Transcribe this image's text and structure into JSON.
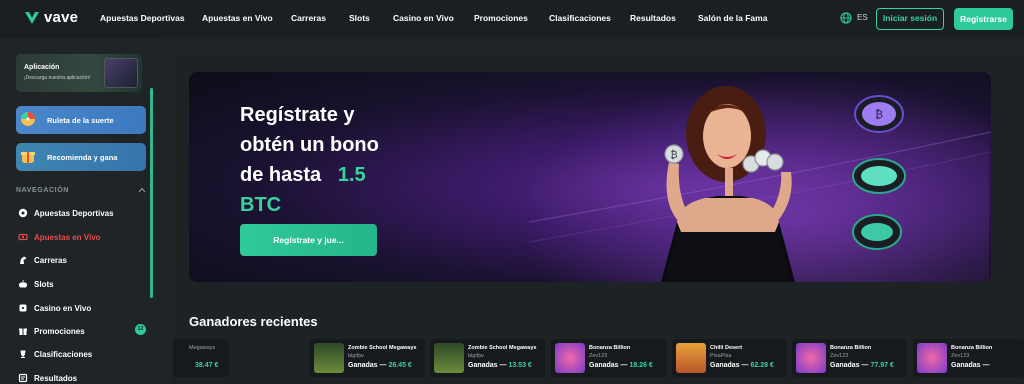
{
  "brand": {
    "name": "vave",
    "accent": "#2fc99a",
    "live_color": "#e84a4a"
  },
  "nav": {
    "links": [
      "Apuestas Deportivas",
      "Apuestas en Vivo",
      "Carreras",
      "Slots",
      "Casino en Vivo",
      "Promociones",
      "Clasificaciones",
      "Resultados",
      "Salón de la Fama"
    ],
    "language": "ES",
    "login_label": "Iniciar sesión",
    "register_label": "Registrarse"
  },
  "sidebar": {
    "app": {
      "title": "Aplicación",
      "subtitle": "¡Descarga nuestra aplicación!"
    },
    "promos": [
      {
        "label": "Ruleta de la suerte",
        "icon": "wheel-icon"
      },
      {
        "label": "Recomienda y gana",
        "icon": "gift-icon"
      }
    ],
    "section_label": "NAVEGACIÓN",
    "items": [
      {
        "label": "Apuestas Deportivas",
        "icon": "soccer-ball-icon"
      },
      {
        "label": "Apuestas en Vivo",
        "icon": "live-icon",
        "active": true
      },
      {
        "label": "Carreras",
        "icon": "horse-icon"
      },
      {
        "label": "Slots",
        "icon": "slots-icon"
      },
      {
        "label": "Casino en Vivo",
        "icon": "casino-icon"
      },
      {
        "label": "Promociones",
        "icon": "gift-icon",
        "badge": "12"
      },
      {
        "label": "Clasificaciones",
        "icon": "trophy-icon"
      },
      {
        "label": "Resultados",
        "icon": "results-icon"
      }
    ]
  },
  "hero": {
    "title_line1": "Regístrate y",
    "title_line2": "obtén un bono",
    "title_line3_prefix": "de hasta",
    "title_amount": "1.5",
    "title_currency": "BTC",
    "cta_label": "Regístrate y jue..."
  },
  "winners": {
    "title": "Ganadores recientes",
    "partial": {
      "game": "Megaways",
      "amount": "38.47 €"
    },
    "cards": [
      {
        "game": "Zombie School Megaways",
        "user": "bigdjw",
        "label": "Ganadas —",
        "amount": "26.45 €",
        "thumb": "zombie"
      },
      {
        "game": "Zombie School Megaways",
        "user": "bigdjw",
        "label": "Ganadas —",
        "amount": "13.53 €",
        "thumb": "zombie"
      },
      {
        "game": "Bonanza Billion",
        "user": "Zev123",
        "label": "Ganadas —",
        "amount": "18.26 €",
        "thumb": "bonanza"
      },
      {
        "game": "Chilli Desert",
        "user": "PisaPisa",
        "label": "Ganadas —",
        "amount": "62.28 €",
        "thumb": "chilli"
      },
      {
        "game": "Bonanza Billion",
        "user": "Zev123",
        "label": "Ganadas —",
        "amount": "77.97 €",
        "thumb": "bonanza"
      },
      {
        "game": "Bonanza Billion",
        "user": "Zev123",
        "label": "Ganadas —",
        "amount": "",
        "thumb": "bonanza"
      }
    ]
  }
}
